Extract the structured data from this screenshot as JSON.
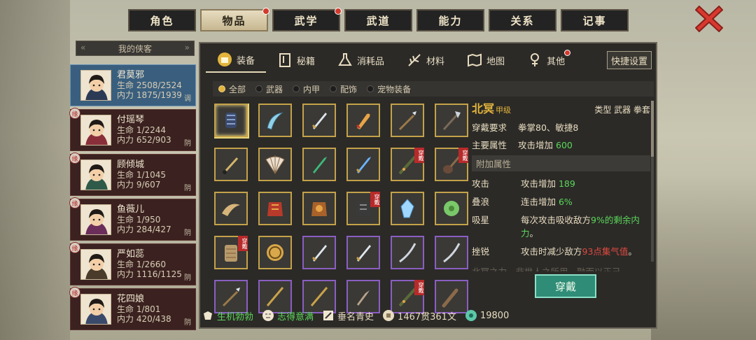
{
  "colors": {
    "accent_gold": "#e4b53c",
    "accent_green": "#5bd75a",
    "accent_red": "#e0493f",
    "button_teal": "#2f8c77"
  },
  "top_tabs": [
    {
      "label": "角色",
      "badge": false
    },
    {
      "label": "物品",
      "badge": true,
      "active": true
    },
    {
      "label": "武学",
      "badge": true
    },
    {
      "label": "武道",
      "badge": false
    },
    {
      "label": "能力",
      "badge": false
    },
    {
      "label": "关系",
      "badge": false
    },
    {
      "label": "记事",
      "badge": false
    }
  ],
  "left_panel": {
    "header": "我的侠客",
    "heroes": [
      {
        "name": "君莫邪",
        "hp": "生命 2508/2524",
        "mp": "内力 1875/1939",
        "flag": "调",
        "tag": ""
      },
      {
        "name": "付瑶琴",
        "hp": "生命 1/2244",
        "mp": "内力 652/903",
        "flag": "阴",
        "tag": "缘"
      },
      {
        "name": "顾倾城",
        "hp": "生命 1/1045",
        "mp": "内力 9/607",
        "flag": "阴",
        "tag": "缘"
      },
      {
        "name": "鱼薇儿",
        "hp": "生命 1/950",
        "mp": "内力 284/427",
        "flag": "阴",
        "tag": "缘"
      },
      {
        "name": "严如蕊",
        "hp": "生命 1/2660",
        "mp": "内力 1116/1125",
        "flag": "阴",
        "tag": "缘"
      },
      {
        "name": "花四娘",
        "hp": "生命 1/801",
        "mp": "内力 420/438",
        "flag": "阴",
        "tag": "缘"
      }
    ]
  },
  "sub_tabs": [
    {
      "label": "装备",
      "icon": "armor-icon",
      "active": true
    },
    {
      "label": "秘籍",
      "icon": "book-icon"
    },
    {
      "label": "消耗品",
      "icon": "potion-icon"
    },
    {
      "label": "材料",
      "icon": "herb-icon"
    },
    {
      "label": "地图",
      "icon": "map-icon"
    },
    {
      "label": "其他",
      "icon": "misc-icon",
      "badge": true
    }
  ],
  "quick_settings": "快捷设置",
  "filters": [
    {
      "label": "全部",
      "on": true
    },
    {
      "label": "武器",
      "on": false
    },
    {
      "label": "内甲",
      "on": false
    },
    {
      "label": "配饰",
      "on": false
    },
    {
      "label": "宠物装备",
      "on": false
    }
  ],
  "worn_label": "穿戴",
  "items": [
    {
      "icon": "gauntlet-icon",
      "rarity": "gold",
      "selected": true
    },
    {
      "icon": "sickle-blade-icon",
      "rarity": "gold"
    },
    {
      "icon": "sword-icon",
      "rarity": "gold"
    },
    {
      "icon": "broadsword-icon",
      "rarity": "gold"
    },
    {
      "icon": "spear-icon",
      "rarity": "gold"
    },
    {
      "icon": "halberd-icon",
      "rarity": "gold"
    },
    {
      "icon": "brush-icon",
      "rarity": "gold"
    },
    {
      "icon": "fan-icon",
      "rarity": "gold"
    },
    {
      "icon": "jade-dagger-icon",
      "rarity": "gold"
    },
    {
      "icon": "blue-blade-icon",
      "rarity": "gold"
    },
    {
      "icon": "flute-icon",
      "rarity": "gold",
      "worn": true
    },
    {
      "icon": "pipa-icon",
      "rarity": "gold",
      "worn": true
    },
    {
      "icon": "horn-icon",
      "rarity": "gold"
    },
    {
      "icon": "red-armor-icon",
      "rarity": "gold"
    },
    {
      "icon": "bronze-armor-icon",
      "rarity": "gold"
    },
    {
      "icon": "dark-armor-icon",
      "rarity": "gold",
      "worn": true
    },
    {
      "icon": "crystal-icon",
      "rarity": "gold"
    },
    {
      "icon": "jade-pendant-icon",
      "rarity": "gold"
    },
    {
      "icon": "scroll-pouch-icon",
      "rarity": "gold",
      "worn": true
    },
    {
      "icon": "medallion-icon",
      "rarity": "gold"
    },
    {
      "icon": "sword-icon",
      "rarity": "purple"
    },
    {
      "icon": "sword-icon",
      "rarity": "purple"
    },
    {
      "icon": "saber-icon",
      "rarity": "purple"
    },
    {
      "icon": "saber-icon",
      "rarity": "purple"
    },
    {
      "icon": "spear-icon",
      "rarity": "purple"
    },
    {
      "icon": "staff-icon",
      "rarity": "purple"
    },
    {
      "icon": "staff-icon",
      "rarity": "purple"
    },
    {
      "icon": "dagger-icon",
      "rarity": "purple"
    },
    {
      "icon": "flute-icon",
      "rarity": "purple",
      "worn": true
    },
    {
      "icon": "club-icon",
      "rarity": "purple"
    }
  ],
  "detail": {
    "name": "北冥",
    "grade": "甲级",
    "type": "类型  武器 拳套",
    "req_label": "穿戴要求",
    "req_value": "拳掌80、敏捷8",
    "main_label": "主要属性",
    "main_value": "攻击增加",
    "main_num": "600",
    "extra_header": "附加属性",
    "attrs": [
      {
        "k": "攻击",
        "v": "攻击增加 ",
        "n": "189",
        "tail": ""
      },
      {
        "k": "叠浪",
        "v": "连击增加 ",
        "n": "6%",
        "tail": ""
      },
      {
        "k": "吸星",
        "v": "每次攻击吸收敌方",
        "n": "9%的剩余内力",
        "tail": "。"
      },
      {
        "k": "挫锐",
        "v": "攻击时减少敌方",
        "n": "93点集气值",
        "tail": "。"
      }
    ],
    "fade_text": "北冥之力，非世人之所用，融而以正己"
  },
  "equip_button": "穿戴",
  "status": [
    {
      "label": "生机勃勃",
      "icon": "vitality-icon",
      "color": "green"
    },
    {
      "label": "志得意满",
      "icon": "mood-icon",
      "color": "green"
    },
    {
      "label": "垂名青史",
      "icon": "fame-icon",
      "color": "white"
    },
    {
      "label": "1467贯361文",
      "icon": "coin-icon",
      "color": "white"
    },
    {
      "label": "19800",
      "icon": "jade-coin-icon",
      "color": "white"
    }
  ]
}
